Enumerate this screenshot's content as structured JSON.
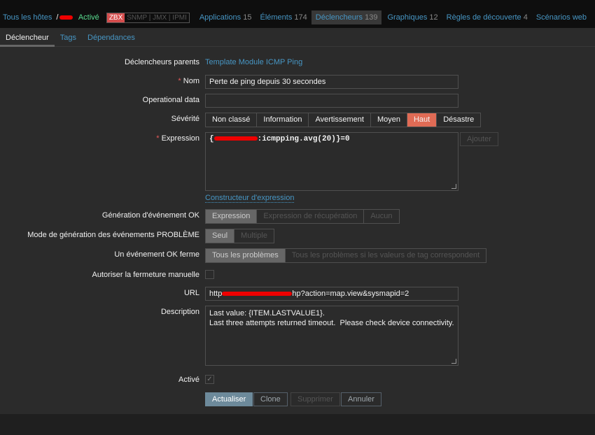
{
  "header": {
    "all_hosts": "Tous les hôtes",
    "separator": "/",
    "status": "Activé",
    "zbx": "ZBX",
    "interfaces": "SNMP | JMX | IPMI",
    "nav": [
      {
        "label": "Applications",
        "count": "15"
      },
      {
        "label": "Éléments",
        "count": "174"
      },
      {
        "label": "Déclencheurs",
        "count": "139",
        "active": true
      },
      {
        "label": "Graphiques",
        "count": "12"
      },
      {
        "label": "Règles de découverte",
        "count": "4"
      },
      {
        "label": "Scénarios web",
        "count": ""
      }
    ]
  },
  "tabs": [
    "Déclencheur",
    "Tags",
    "Dépendances"
  ],
  "form": {
    "parent_label": "Déclencheurs parents",
    "parent_value": "Template Module ICMP Ping",
    "name_label": "Nom",
    "name_value": "Perte de ping depuis 30 secondes",
    "opdata_label": "Operational data",
    "opdata_value": "",
    "severity_label": "Sévérité",
    "severities": [
      "Non classé",
      "Information",
      "Avertissement",
      "Moyen",
      "Haut",
      "Désastre"
    ],
    "severity_selected": "Haut",
    "expression_label": "Expression",
    "expression_prefix": "{",
    "expression_value": ":icmpping.avg(20)}=0",
    "add_button": "Ajouter",
    "expression_builder": "Constructeur d'expression",
    "ok_gen_label": "Génération d'événement OK",
    "ok_gen_options": [
      "Expression",
      "Expression de récupération",
      "Aucun"
    ],
    "problem_mode_label": "Mode de génération des événements PROBLÈME",
    "problem_mode_options": [
      "Seul",
      "Multiple"
    ],
    "ok_close_label": "Un événement OK ferme",
    "ok_close_options": [
      "Tous les problèmes",
      "Tous les problèmes si les valeurs de tag correspondent"
    ],
    "manual_close_label": "Autoriser la fermeture manuelle",
    "manual_close_checked": false,
    "url_label": "URL",
    "url_prefix": "http",
    "url_suffix": "hp?action=map.view&sysmapid=2",
    "description_label": "Description",
    "description_value": "Last value: {ITEM.LASTVALUE1}.\nLast three attempts returned timeout.  Please check device connectivity.",
    "enabled_label": "Activé",
    "enabled_checked": true,
    "buttons": {
      "update": "Actualiser",
      "clone": "Clone",
      "delete": "Supprimer",
      "cancel": "Annuler"
    }
  },
  "colors": {
    "accent": "#4796c4",
    "severity_high": "#e06b55",
    "status_green": "#59db8f"
  }
}
